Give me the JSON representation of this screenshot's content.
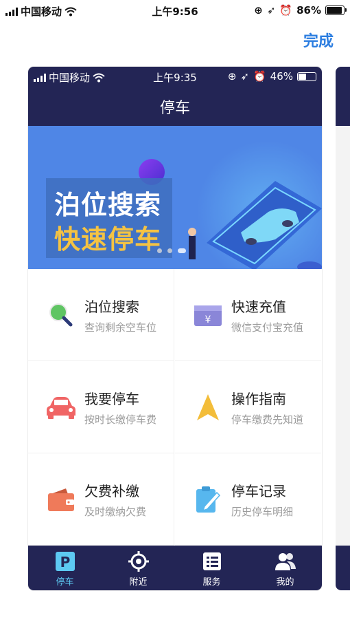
{
  "outer_status": {
    "carrier": "中国移动",
    "time": "上午9:56",
    "battery": "86%"
  },
  "header": {
    "done_label": "完成"
  },
  "inner_status": {
    "carrier": "中国移动",
    "time": "上午9:35",
    "battery": "46%"
  },
  "page_title": "停车",
  "banner": {
    "line1": "泊位搜索",
    "line2": "快速停车"
  },
  "menu": [
    {
      "title": "泊位搜索",
      "subtitle": "查询剩余空车位",
      "icon": "magnifier-icon"
    },
    {
      "title": "快速充值",
      "subtitle": "微信支付宝充值",
      "icon": "wallet-card-icon"
    },
    {
      "title": "我要停车",
      "subtitle": "按时长缴停车费",
      "icon": "car-icon"
    },
    {
      "title": "操作指南",
      "subtitle": "停车缴费先知道",
      "icon": "navigation-arrow-icon"
    },
    {
      "title": "欠费补缴",
      "subtitle": "及时缴纳欠费",
      "icon": "purse-icon"
    },
    {
      "title": "停车记录",
      "subtitle": "历史停车明细",
      "icon": "edit-note-icon"
    }
  ],
  "tabs": [
    {
      "label": "停车",
      "icon": "parking-icon",
      "active": true
    },
    {
      "label": "附近",
      "icon": "location-target-icon",
      "active": false
    },
    {
      "label": "服务",
      "icon": "list-icon",
      "active": false
    },
    {
      "label": "我的",
      "icon": "users-icon",
      "active": false
    }
  ],
  "colors": {
    "accent": "#2b7de0",
    "nav": "#232555",
    "banner": "#4f86e6",
    "tab_active": "#5dc9f2"
  }
}
